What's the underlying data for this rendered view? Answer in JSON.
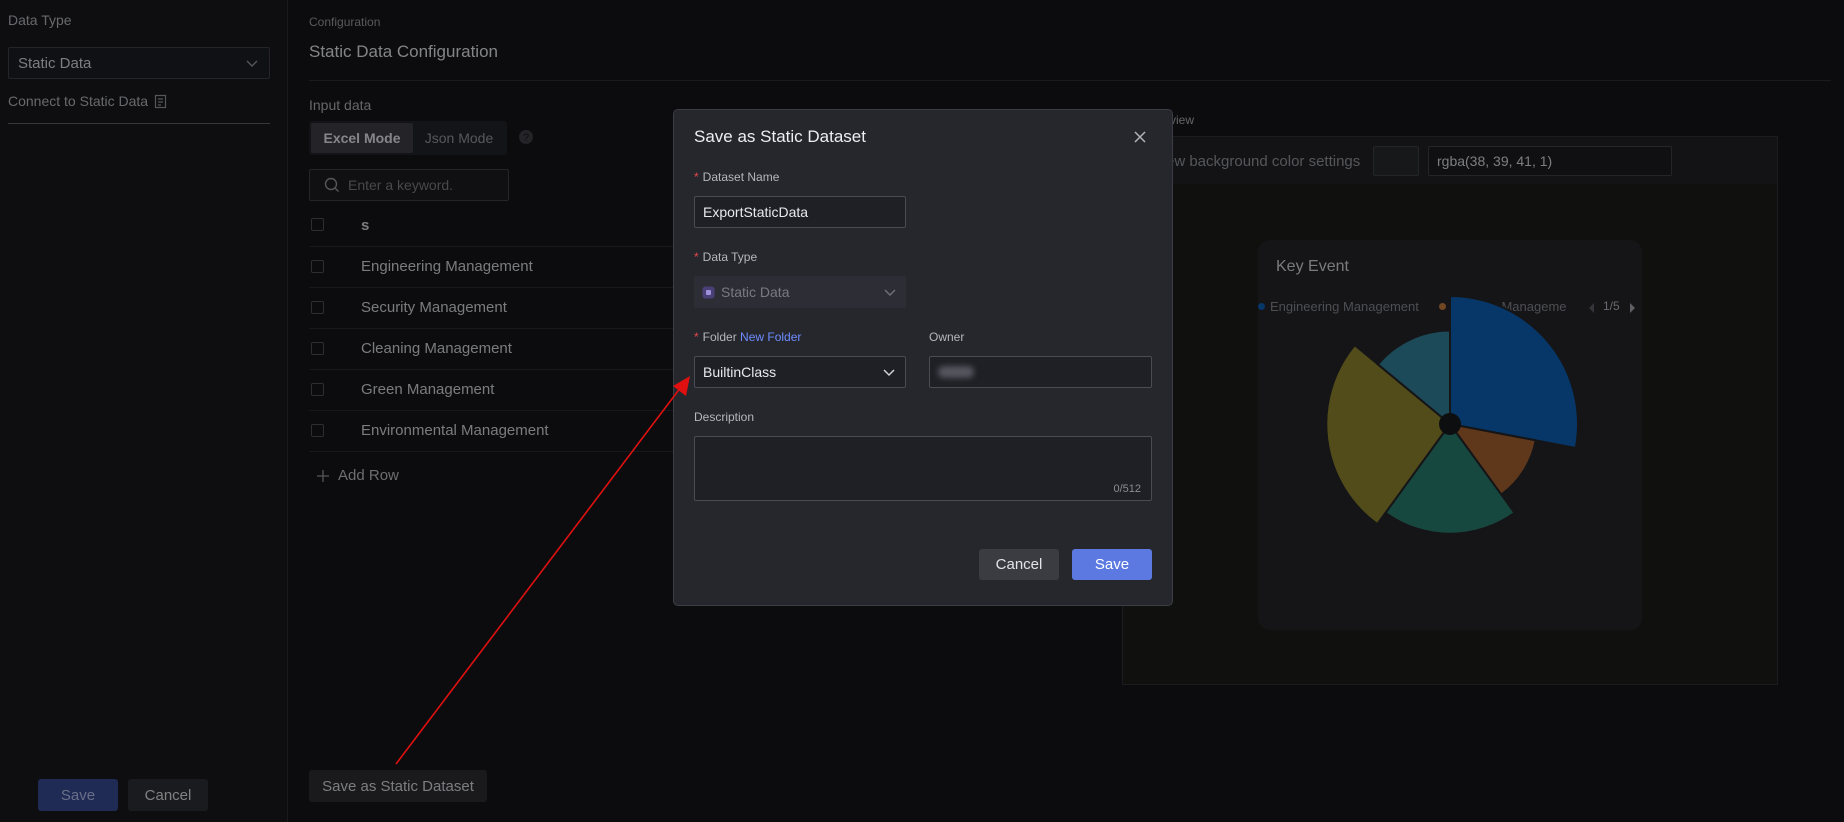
{
  "left_panel": {
    "data_type_label": "Data Type",
    "data_type_value": "Static Data",
    "connect_label": "Connect to Static Data",
    "save_label": "Save",
    "cancel_label": "Cancel"
  },
  "main": {
    "breadcrumb": "Configuration",
    "title": "Static Data Configuration",
    "input_label": "Input data",
    "modes": [
      "Excel Mode",
      "Json Mode"
    ],
    "search_placeholder": "Enter a keyword.",
    "column_header": "s",
    "rows": [
      "Engineering Management",
      "Security Management",
      "Cleaning Management",
      "Green Management",
      "Environmental Management"
    ],
    "add_row_label": "Add Row",
    "save_static_label": "Save as Static Dataset"
  },
  "preview": {
    "label": "view",
    "bg_setting_label": "ew background color settings",
    "bg_color_value": "rgba(38, 39, 41, 1)",
    "card_title": "Key Event",
    "legend": [
      {
        "name": "Engineering Management",
        "color": "#0a5aa8"
      },
      {
        "name": "Security Manageme",
        "color": "#b9743a"
      }
    ],
    "pager": "1/5"
  },
  "chart_data": {
    "type": "pie",
    "title": "Key Event",
    "categories": [
      "Engineering Management",
      "Security Management",
      "Cleaning Management",
      "Green Management",
      "Environmental Management"
    ],
    "values": [
      28,
      12,
      20,
      26,
      14
    ],
    "colors": [
      "#0a5aa8",
      "#9a5a2c",
      "#267566",
      "#857a2a",
      "#2f7890"
    ],
    "legend_position": "top"
  },
  "modal": {
    "title": "Save as Static Dataset",
    "dataset_name_label": "Dataset Name",
    "dataset_name_value": "ExportStaticData",
    "data_type_label": "Data Type",
    "data_type_value": "Static Data",
    "folder_label": "Folder",
    "new_folder_link": "New Folder",
    "folder_value": "BuiltinClass",
    "owner_label": "Owner",
    "description_label": "Description",
    "description_counter": "0/512",
    "cancel_label": "Cancel",
    "save_label": "Save"
  },
  "colors": {
    "accent": "#5b79e0",
    "link": "#6d8cff",
    "annotation_arrow": "#e01010"
  }
}
